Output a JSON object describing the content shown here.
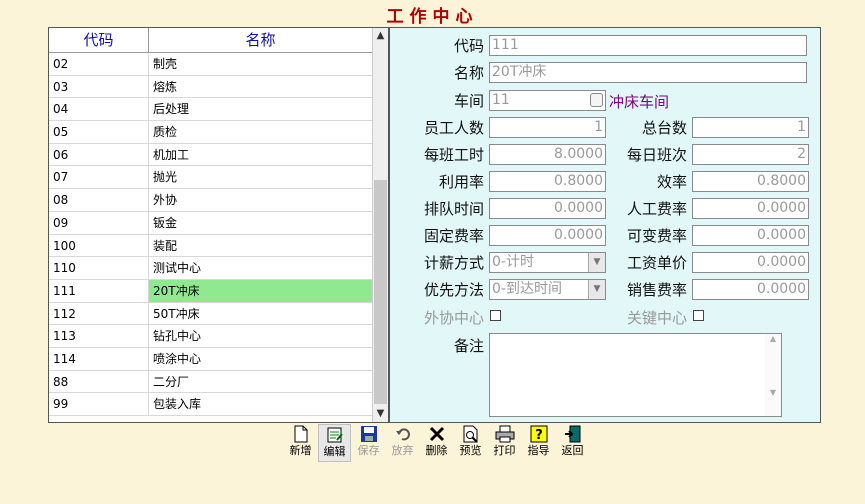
{
  "title": "工作中心",
  "list": {
    "headers": {
      "code": "代码",
      "name": "名称"
    },
    "rows": [
      {
        "code": "02",
        "name": "制壳"
      },
      {
        "code": "03",
        "name": "熔炼"
      },
      {
        "code": "04",
        "name": "后处理"
      },
      {
        "code": "05",
        "name": "质检"
      },
      {
        "code": "06",
        "name": "机加工"
      },
      {
        "code": "07",
        "name": "抛光"
      },
      {
        "code": "08",
        "name": "外协"
      },
      {
        "code": "09",
        "name": "钣金"
      },
      {
        "code": "100",
        "name": "装配"
      },
      {
        "code": "110",
        "name": "测试中心"
      },
      {
        "code": "111",
        "name": "20T冲床"
      },
      {
        "code": "112",
        "name": "50T冲床"
      },
      {
        "code": "113",
        "name": "钻孔中心"
      },
      {
        "code": "114",
        "name": "喷涂中心"
      },
      {
        "code": "88",
        "name": "二分厂"
      },
      {
        "code": "99",
        "name": "包装入库"
      }
    ],
    "selected_code": "111"
  },
  "form": {
    "code_label": "代码",
    "code_value": "111",
    "name_label": "名称",
    "name_value": "20T冲床",
    "workshop_label": "车间",
    "workshop_value": "11",
    "workshop_name": "冲床车间",
    "staff_label": "员工人数",
    "staff_value": "1",
    "machines_label": "总台数",
    "machines_value": "1",
    "shift_hours_label": "每班工时",
    "shift_hours_value": "8.0000",
    "shifts_label": "每日班次",
    "shifts_value": "2",
    "utilization_label": "利用率",
    "utilization_value": "0.8000",
    "efficiency_label": "效率",
    "efficiency_value": "0.8000",
    "queue_label": "排队时间",
    "queue_value": "0.0000",
    "labor_rate_label": "人工费率",
    "labor_rate_value": "0.0000",
    "fixed_rate_label": "固定费率",
    "fixed_rate_value": "0.0000",
    "variable_rate_label": "可变费率",
    "variable_rate_value": "0.0000",
    "pay_method_label": "计薪方式",
    "pay_method_value": "0-计时",
    "wage_price_label": "工资单价",
    "wage_price_value": "0.0000",
    "priority_label": "优先方法",
    "priority_value": "0-到达时间",
    "sales_rate_label": "销售费率",
    "sales_rate_value": "0.0000",
    "outsource_label": "外协中心",
    "key_center_label": "关键中心",
    "remark_label": "备注"
  },
  "toolbar": {
    "new": "新增",
    "edit": "编辑",
    "save": "保存",
    "discard": "放弃",
    "delete": "删除",
    "preview": "预览",
    "print": "打印",
    "guide": "指导",
    "back": "返回"
  },
  "colors": {
    "title": "#b00000",
    "selected_row": "#90e890",
    "form_bg": "#e1f7f8",
    "workshop_name": "#800080"
  }
}
